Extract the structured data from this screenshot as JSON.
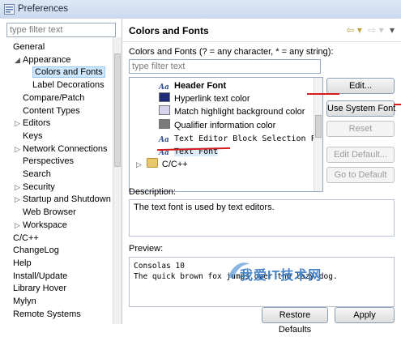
{
  "window": {
    "title": "Preferences"
  },
  "left": {
    "filter_placeholder": "type filter text",
    "tree": [
      {
        "label": "General",
        "arrow": "",
        "indent": 0
      },
      {
        "label": "Appearance",
        "arrow": "◢",
        "indent": 1
      },
      {
        "label": "Colors and Fonts",
        "arrow": "",
        "indent": 2,
        "selected": true
      },
      {
        "label": "Label Decorations",
        "arrow": "",
        "indent": 2
      },
      {
        "label": "Compare/Patch",
        "arrow": "",
        "indent": 1
      },
      {
        "label": "Content Types",
        "arrow": "",
        "indent": 1
      },
      {
        "label": "Editors",
        "arrow": "▷",
        "indent": 1
      },
      {
        "label": "Keys",
        "arrow": "",
        "indent": 1
      },
      {
        "label": "Network Connections",
        "arrow": "▷",
        "indent": 1
      },
      {
        "label": "Perspectives",
        "arrow": "",
        "indent": 1
      },
      {
        "label": "Search",
        "arrow": "",
        "indent": 1
      },
      {
        "label": "Security",
        "arrow": "▷",
        "indent": 1
      },
      {
        "label": "Startup and Shutdown",
        "arrow": "▷",
        "indent": 1
      },
      {
        "label": "Web Browser",
        "arrow": "",
        "indent": 1
      },
      {
        "label": "Workspace",
        "arrow": "▷",
        "indent": 1
      },
      {
        "label": "C/C++",
        "arrow": "",
        "indent": 0
      },
      {
        "label": "ChangeLog",
        "arrow": "",
        "indent": 0
      },
      {
        "label": "Help",
        "arrow": "",
        "indent": 0
      },
      {
        "label": "Install/Update",
        "arrow": "",
        "indent": 0
      },
      {
        "label": "Library Hover",
        "arrow": "",
        "indent": 0
      },
      {
        "label": "Mylyn",
        "arrow": "",
        "indent": 0
      },
      {
        "label": "Remote Systems",
        "arrow": "",
        "indent": 0
      }
    ]
  },
  "right": {
    "page_title": "Colors and Fonts",
    "filter_label": "Colors and Fonts (? = any character, * = any string):",
    "filter_placeholder": "type filter text",
    "font_items": [
      {
        "label": "Header Font",
        "icon": "font-icon",
        "bold": true
      },
      {
        "label": "Hyperlink text color",
        "icon": "color-swatch-icon",
        "color": "#1d2a7a"
      },
      {
        "label": "Match highlight background color",
        "icon": "color-swatch-icon",
        "color": "#d8d4f0"
      },
      {
        "label": "Qualifier information color",
        "icon": "color-swatch-icon",
        "color": "#7a7a7a"
      },
      {
        "label": "Text Editor Block Selection Font",
        "icon": "font-icon",
        "mono": true
      },
      {
        "label": "Text Font",
        "icon": "font-icon",
        "mono": true,
        "selected": true
      },
      {
        "label": "C/C++",
        "icon": "folder-icon",
        "arrow": "▷"
      }
    ],
    "buttons": {
      "edit": "Edit...",
      "use_system_font": "Use System Font",
      "reset": "Reset",
      "edit_default": "Edit Default...",
      "go_to_default": "Go to Default"
    },
    "description_label": "Description:",
    "description_text": "The text font is used by text editors.",
    "preview_label": "Preview:",
    "preview_lines": [
      "Consolas 10",
      "The quick brown fox jumps over the lazy dog."
    ],
    "restore_defaults": "Restore Defaults",
    "apply": "Apply"
  },
  "watermark": {
    "text": "我爱IT技术网"
  },
  "colors": {
    "accent_red": "#d51b1b",
    "selection": "#cde6fb"
  }
}
